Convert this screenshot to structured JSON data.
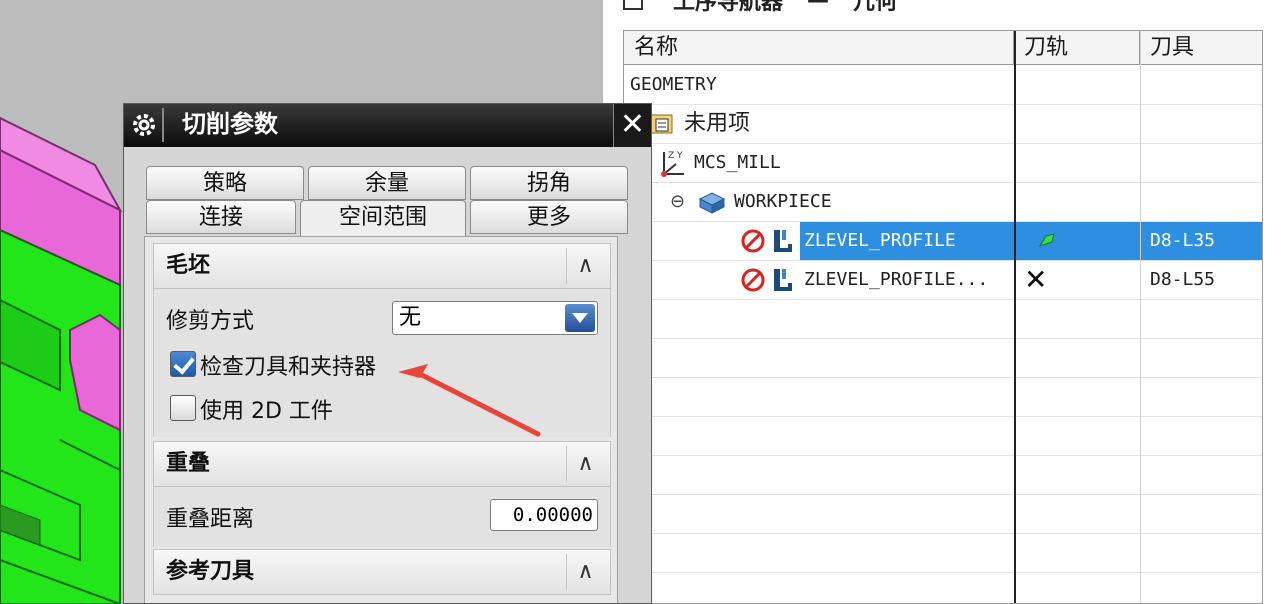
{
  "navigator": {
    "title_left": "工序导航器",
    "title_sep": "—",
    "title_right": "几何",
    "columns": [
      "名称",
      "刀轨",
      "刀具"
    ],
    "rows": [
      {
        "name": "GEOMETRY",
        "toolpath": "",
        "tool": ""
      },
      {
        "name": "未用项",
        "toolpath": "",
        "tool": ""
      },
      {
        "name": "MCS_MILL",
        "toolpath": "",
        "tool": ""
      },
      {
        "name": "WORKPIECE",
        "toolpath": "",
        "tool": ""
      },
      {
        "name": "ZLEVEL_PROFILE",
        "toolpath": "",
        "tool": "D8-L35"
      },
      {
        "name": "ZLEVEL_PROFILE...",
        "toolpath": "",
        "tool": "D8-L55"
      }
    ],
    "tree_expand_symbol": "⊖",
    "toolpath_ok_icon": "toolpath-ok-icon",
    "toolpath_missing_symbol": "✕",
    "selection_color": "#2e8ee0"
  },
  "dialog": {
    "title": "切削参数",
    "close_symbol": "✕",
    "tabs_row1": [
      "策略",
      "余量",
      "拐角"
    ],
    "tabs_row2": [
      "连接",
      "空间范围",
      "更多"
    ],
    "active_tab": "空间范围",
    "sections": [
      {
        "label": "毛坯",
        "toggle": "∧"
      },
      {
        "label": "重叠",
        "toggle": "∧"
      },
      {
        "label": "参考刀具",
        "toggle": "∧"
      }
    ],
    "trim_label": "修剪方式",
    "trim_value": "无",
    "check_tool_label": "检查刀具和夹持器",
    "check_tool_checked": true,
    "use_2d_label": "使用 2D 工件",
    "use_2d_checked": false,
    "overlap_label": "重叠距离",
    "overlap_value": "0.00000"
  },
  "colors": {
    "model_green": "#22e61a",
    "model_magenta": "#e768d6",
    "annotation_arrow": "#e8443a",
    "dialog_titlebar": "#111111"
  }
}
